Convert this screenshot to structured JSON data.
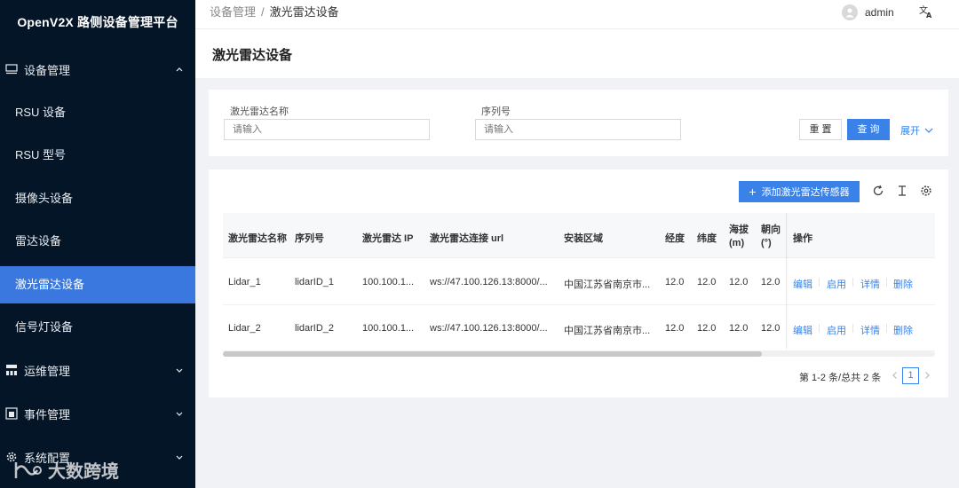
{
  "app": {
    "title": "OpenV2X 路侧设备管理平台"
  },
  "sidebar": {
    "groups": [
      {
        "label": "设备管理",
        "icon": "monitor-icon",
        "expanded": true
      },
      {
        "label": "运维管理",
        "icon": "org-chart-icon",
        "expanded": false
      },
      {
        "label": "事件管理",
        "icon": "event-icon",
        "expanded": false
      },
      {
        "label": "系统配置",
        "icon": "gear-icon",
        "expanded": false
      }
    ],
    "items": [
      {
        "label": "RSU 设备",
        "active": false
      },
      {
        "label": "RSU 型号",
        "active": false
      },
      {
        "label": "摄像头设备",
        "active": false
      },
      {
        "label": "雷达设备",
        "active": false
      },
      {
        "label": "激光雷达设备",
        "active": true
      },
      {
        "label": "信号灯设备",
        "active": false
      }
    ]
  },
  "header": {
    "breadcrumb": {
      "parent": "设备管理",
      "separator": "/",
      "current": "激光雷达设备"
    },
    "user": "admin",
    "lang_icon": "translate-icon"
  },
  "page": {
    "title": "激光雷达设备"
  },
  "search": {
    "fields": [
      {
        "label": "激光雷达名称",
        "placeholder": "请输入",
        "value": ""
      },
      {
        "label": "序列号",
        "placeholder": "请输入",
        "value": ""
      }
    ],
    "reset_label": "重 置",
    "query_label": "查 询",
    "expand_label": "展开"
  },
  "table": {
    "add_label": "添加激光雷达传感器",
    "toolbar_icons": [
      "refresh-icon",
      "column-height-icon",
      "settings-icon"
    ],
    "columns": [
      "激光雷达名称",
      "序列号",
      "激光雷达 IP",
      "激光雷达连接 url",
      "安装区域",
      "经度",
      "纬度",
      "海拔",
      "(m)",
      "朝向",
      "(°)",
      "操作"
    ],
    "rows": [
      {
        "name": "Lidar_1",
        "sn": "lidarID_1",
        "ip": "100.100.1...",
        "url": "ws://47.100.126.13:8000/...",
        "area": "中国江苏省南京市...",
        "lng": "12.0",
        "lat": "12.0",
        "alt": "12.0",
        "heading": "12.0"
      },
      {
        "name": "Lidar_2",
        "sn": "lidarID_2",
        "ip": "100.100.1...",
        "url": "ws://47.100.126.13:8000/...",
        "area": "中国江苏省南京市...",
        "lng": "12.0",
        "lat": "12.0",
        "alt": "12.0",
        "heading": "12.0"
      }
    ],
    "actions": [
      "编辑",
      "启用",
      "详情",
      "删除"
    ]
  },
  "pagination": {
    "summary": "第 1-2 条/总共 2 条",
    "current_page": "1"
  },
  "watermark": {
    "text": "大数跨境"
  },
  "colors": {
    "sidebar_bg": "#041527",
    "accent": "#3a82e8",
    "active_item": "#3a78e0"
  }
}
